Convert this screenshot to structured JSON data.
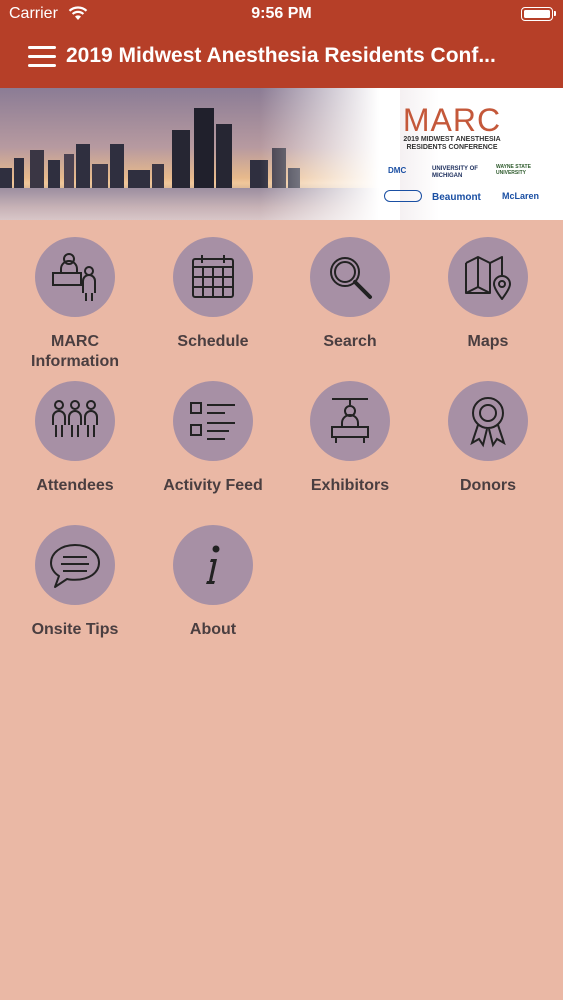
{
  "status_bar": {
    "carrier": "Carrier",
    "time": "9:56 PM"
  },
  "header": {
    "title": "2019 Midwest Anesthesia Residents Conf..."
  },
  "banner": {
    "logo_text": "MARC",
    "logo_line1": "2019 MIDWEST ANESTHESIA",
    "logo_line2": "RESIDENTS CONFERENCE",
    "sponsors": [
      "DMC",
      "UNIVERSITY OF MICHIGAN",
      "WAYNE STATE UNIVERSITY",
      "Beaumont",
      "McLaren"
    ]
  },
  "menu_items": [
    {
      "label": "MARC Information",
      "icon": "reception-desk-icon"
    },
    {
      "label": "Schedule",
      "icon": "calendar-icon"
    },
    {
      "label": "Search",
      "icon": "search-icon"
    },
    {
      "label": "Maps",
      "icon": "map-icon"
    },
    {
      "label": "Attendees",
      "icon": "people-group-icon"
    },
    {
      "label": "Activity Feed",
      "icon": "list-icon"
    },
    {
      "label": "Exhibitors",
      "icon": "exhibitor-booth-icon"
    },
    {
      "label": "Donors",
      "icon": "award-ribbon-icon"
    },
    {
      "label": "Onsite Tips",
      "icon": "chat-bubble-icon"
    },
    {
      "label": "About",
      "icon": "info-icon"
    }
  ],
  "colors": {
    "header": "#b63f28",
    "background": "#eab8a5",
    "icon_circle": "#a790a5",
    "label": "#4a3e40"
  }
}
